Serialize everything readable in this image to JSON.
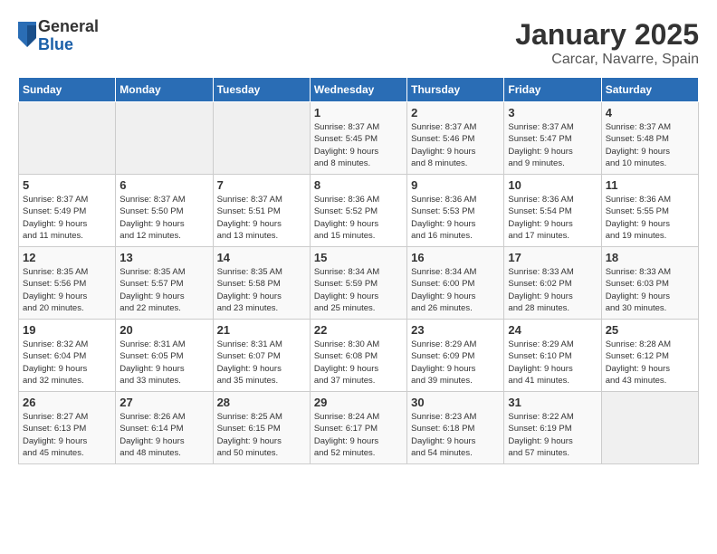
{
  "logo": {
    "general": "General",
    "blue": "Blue"
  },
  "title": "January 2025",
  "subtitle": "Carcar, Navarre, Spain",
  "headers": [
    "Sunday",
    "Monday",
    "Tuesday",
    "Wednesday",
    "Thursday",
    "Friday",
    "Saturday"
  ],
  "weeks": [
    [
      {
        "day": "",
        "info": ""
      },
      {
        "day": "",
        "info": ""
      },
      {
        "day": "",
        "info": ""
      },
      {
        "day": "1",
        "info": "Sunrise: 8:37 AM\nSunset: 5:45 PM\nDaylight: 9 hours\nand 8 minutes."
      },
      {
        "day": "2",
        "info": "Sunrise: 8:37 AM\nSunset: 5:46 PM\nDaylight: 9 hours\nand 8 minutes."
      },
      {
        "day": "3",
        "info": "Sunrise: 8:37 AM\nSunset: 5:47 PM\nDaylight: 9 hours\nand 9 minutes."
      },
      {
        "day": "4",
        "info": "Sunrise: 8:37 AM\nSunset: 5:48 PM\nDaylight: 9 hours\nand 10 minutes."
      }
    ],
    [
      {
        "day": "5",
        "info": "Sunrise: 8:37 AM\nSunset: 5:49 PM\nDaylight: 9 hours\nand 11 minutes."
      },
      {
        "day": "6",
        "info": "Sunrise: 8:37 AM\nSunset: 5:50 PM\nDaylight: 9 hours\nand 12 minutes."
      },
      {
        "day": "7",
        "info": "Sunrise: 8:37 AM\nSunset: 5:51 PM\nDaylight: 9 hours\nand 13 minutes."
      },
      {
        "day": "8",
        "info": "Sunrise: 8:36 AM\nSunset: 5:52 PM\nDaylight: 9 hours\nand 15 minutes."
      },
      {
        "day": "9",
        "info": "Sunrise: 8:36 AM\nSunset: 5:53 PM\nDaylight: 9 hours\nand 16 minutes."
      },
      {
        "day": "10",
        "info": "Sunrise: 8:36 AM\nSunset: 5:54 PM\nDaylight: 9 hours\nand 17 minutes."
      },
      {
        "day": "11",
        "info": "Sunrise: 8:36 AM\nSunset: 5:55 PM\nDaylight: 9 hours\nand 19 minutes."
      }
    ],
    [
      {
        "day": "12",
        "info": "Sunrise: 8:35 AM\nSunset: 5:56 PM\nDaylight: 9 hours\nand 20 minutes."
      },
      {
        "day": "13",
        "info": "Sunrise: 8:35 AM\nSunset: 5:57 PM\nDaylight: 9 hours\nand 22 minutes."
      },
      {
        "day": "14",
        "info": "Sunrise: 8:35 AM\nSunset: 5:58 PM\nDaylight: 9 hours\nand 23 minutes."
      },
      {
        "day": "15",
        "info": "Sunrise: 8:34 AM\nSunset: 5:59 PM\nDaylight: 9 hours\nand 25 minutes."
      },
      {
        "day": "16",
        "info": "Sunrise: 8:34 AM\nSunset: 6:00 PM\nDaylight: 9 hours\nand 26 minutes."
      },
      {
        "day": "17",
        "info": "Sunrise: 8:33 AM\nSunset: 6:02 PM\nDaylight: 9 hours\nand 28 minutes."
      },
      {
        "day": "18",
        "info": "Sunrise: 8:33 AM\nSunset: 6:03 PM\nDaylight: 9 hours\nand 30 minutes."
      }
    ],
    [
      {
        "day": "19",
        "info": "Sunrise: 8:32 AM\nSunset: 6:04 PM\nDaylight: 9 hours\nand 32 minutes."
      },
      {
        "day": "20",
        "info": "Sunrise: 8:31 AM\nSunset: 6:05 PM\nDaylight: 9 hours\nand 33 minutes."
      },
      {
        "day": "21",
        "info": "Sunrise: 8:31 AM\nSunset: 6:07 PM\nDaylight: 9 hours\nand 35 minutes."
      },
      {
        "day": "22",
        "info": "Sunrise: 8:30 AM\nSunset: 6:08 PM\nDaylight: 9 hours\nand 37 minutes."
      },
      {
        "day": "23",
        "info": "Sunrise: 8:29 AM\nSunset: 6:09 PM\nDaylight: 9 hours\nand 39 minutes."
      },
      {
        "day": "24",
        "info": "Sunrise: 8:29 AM\nSunset: 6:10 PM\nDaylight: 9 hours\nand 41 minutes."
      },
      {
        "day": "25",
        "info": "Sunrise: 8:28 AM\nSunset: 6:12 PM\nDaylight: 9 hours\nand 43 minutes."
      }
    ],
    [
      {
        "day": "26",
        "info": "Sunrise: 8:27 AM\nSunset: 6:13 PM\nDaylight: 9 hours\nand 45 minutes."
      },
      {
        "day": "27",
        "info": "Sunrise: 8:26 AM\nSunset: 6:14 PM\nDaylight: 9 hours\nand 48 minutes."
      },
      {
        "day": "28",
        "info": "Sunrise: 8:25 AM\nSunset: 6:15 PM\nDaylight: 9 hours\nand 50 minutes."
      },
      {
        "day": "29",
        "info": "Sunrise: 8:24 AM\nSunset: 6:17 PM\nDaylight: 9 hours\nand 52 minutes."
      },
      {
        "day": "30",
        "info": "Sunrise: 8:23 AM\nSunset: 6:18 PM\nDaylight: 9 hours\nand 54 minutes."
      },
      {
        "day": "31",
        "info": "Sunrise: 8:22 AM\nSunset: 6:19 PM\nDaylight: 9 hours\nand 57 minutes."
      },
      {
        "day": "",
        "info": ""
      }
    ]
  ]
}
